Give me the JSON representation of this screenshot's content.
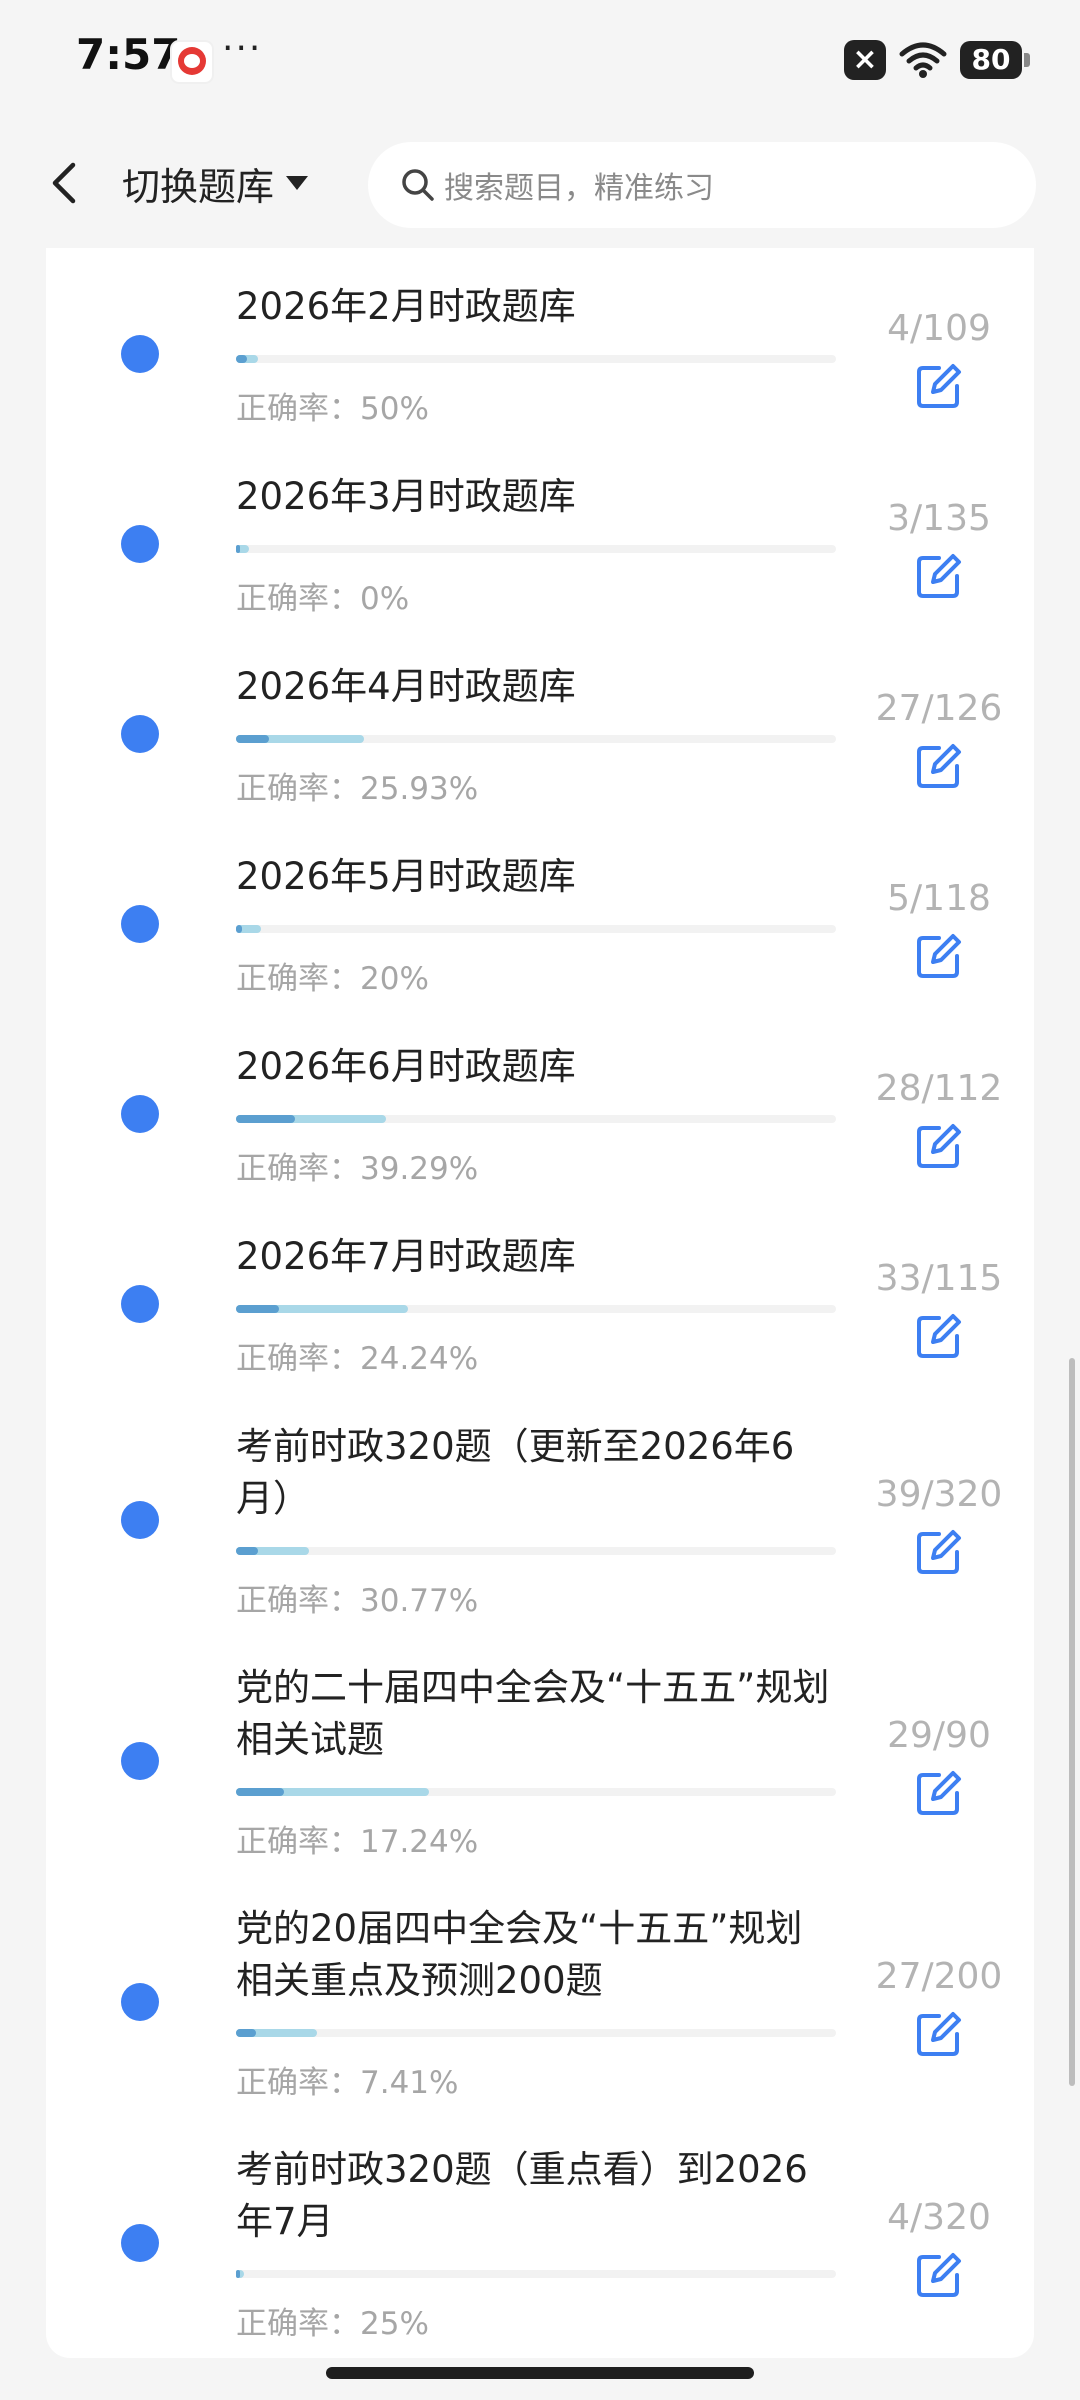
{
  "status_bar": {
    "time": "7:57",
    "more": "···",
    "battery": "80",
    "icons": [
      "app-icon",
      "x-badge-icon",
      "wifi-icon",
      "battery-icon"
    ]
  },
  "header": {
    "switch_label": "切换题库",
    "search_placeholder": "搜索题目，精准练习",
    "icons": [
      "chevron-left-icon",
      "caret-down-icon",
      "search-icon"
    ]
  },
  "colors": {
    "accent": "#3d7ff2",
    "progress_dark": "#5b9fd0",
    "progress_light": "#a9d8e8",
    "muted_text": "#a6a6a6"
  },
  "accuracy_prefix": "正确率：",
  "banks": [
    {
      "title": "2026年2月时政题库",
      "accuracy": "50%",
      "count": "4/109",
      "done_fraction": 0.037,
      "correct_fraction": 0.5
    },
    {
      "title": "2026年3月时政题库",
      "accuracy": "0%",
      "count": "3/135",
      "done_fraction": 0.022,
      "correct_fraction": 0.0
    },
    {
      "title": "2026年4月时政题库",
      "accuracy": "25.93%",
      "count": "27/126",
      "done_fraction": 0.214,
      "correct_fraction": 0.2593
    },
    {
      "title": "2026年5月时政题库",
      "accuracy": "20%",
      "count": "5/118",
      "done_fraction": 0.042,
      "correct_fraction": 0.2
    },
    {
      "title": "2026年6月时政题库",
      "accuracy": "39.29%",
      "count": "28/112",
      "done_fraction": 0.25,
      "correct_fraction": 0.3929
    },
    {
      "title": "2026年7月时政题库",
      "accuracy": "24.24%",
      "count": "33/115",
      "done_fraction": 0.287,
      "correct_fraction": 0.2424
    },
    {
      "title": "考前时政320题（更新至2026年6月）",
      "accuracy": "30.77%",
      "count": "39/320",
      "done_fraction": 0.122,
      "correct_fraction": 0.3077
    },
    {
      "title": "党的二十届四中全会及“十五五”规划相关试题",
      "accuracy": "17.24%",
      "count": "29/90",
      "done_fraction": 0.322,
      "correct_fraction": 0.1724
    },
    {
      "title": "党的20届四中全会及“十五五”规划相关重点及预测200题",
      "accuracy": "7.41%",
      "count": "27/200",
      "done_fraction": 0.135,
      "correct_fraction": 0.0741
    },
    {
      "title": "考前时政320题（重点看）到2026年7月",
      "accuracy": "25%",
      "count": "4/320",
      "done_fraction": 0.0125,
      "correct_fraction": 0.25
    }
  ]
}
